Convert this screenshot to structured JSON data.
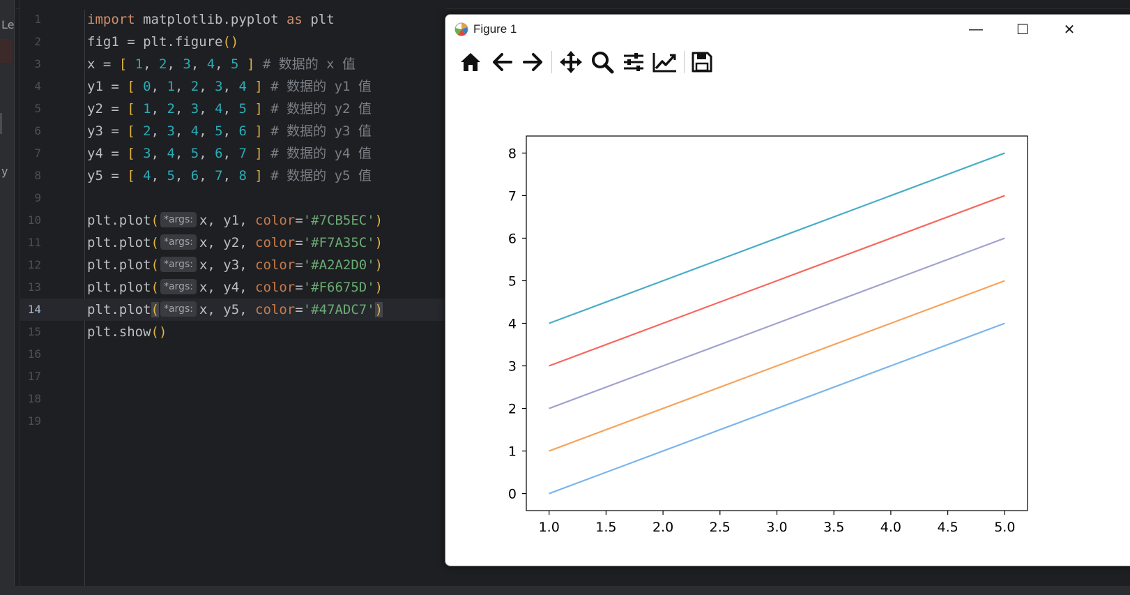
{
  "left_panel": {
    "fragment_top": "Le",
    "fragment_mid": "y"
  },
  "editor": {
    "line_numbers": [
      "1",
      "2",
      "3",
      "4",
      "5",
      "6",
      "7",
      "8",
      "9",
      "10",
      "11",
      "12",
      "13",
      "14",
      "15",
      "16",
      "17",
      "18",
      "19"
    ],
    "current_line": 14,
    "lines": {
      "l1": [
        "import",
        " matplotlib.pyplot ",
        "as",
        " plt"
      ],
      "l2": [
        "fig1 = plt.figure",
        "(",
        ")"
      ],
      "l3": [
        "x = ",
        "[",
        " ",
        "1",
        ", ",
        "2",
        ", ",
        "3",
        ", ",
        "4",
        ", ",
        "5",
        " ",
        "]",
        " ",
        "# 数据的 x 值"
      ],
      "l4": [
        "y1 = ",
        "[",
        " ",
        "0",
        ", ",
        "1",
        ", ",
        "2",
        ", ",
        "3",
        ", ",
        "4",
        " ",
        "]",
        " ",
        "# 数据的 y1 值"
      ],
      "l5": [
        "y2 = ",
        "[",
        " ",
        "1",
        ", ",
        "2",
        ", ",
        "3",
        ", ",
        "4",
        ", ",
        "5",
        " ",
        "]",
        " ",
        "# 数据的 y2 值"
      ],
      "l6": [
        "y3 = ",
        "[",
        " ",
        "2",
        ", ",
        "3",
        ", ",
        "4",
        ", ",
        "5",
        ", ",
        "6",
        " ",
        "]",
        " ",
        "# 数据的 y3 值"
      ],
      "l7": [
        "y4 = ",
        "[",
        " ",
        "3",
        ", ",
        "4",
        ", ",
        "5",
        ", ",
        "6",
        ", ",
        "7",
        " ",
        "]",
        " ",
        "# 数据的 y4 值"
      ],
      "l8": [
        "y5 = ",
        "[",
        " ",
        "4",
        ", ",
        "5",
        ", ",
        "6",
        ", ",
        "7",
        ", ",
        "8",
        " ",
        "]",
        " ",
        "# 数据的 y5 值"
      ],
      "l10": [
        "plt.plot",
        "(",
        "*args:",
        "x, y1, ",
        "color",
        "=",
        "'#7CB5EC'",
        ")"
      ],
      "l11": [
        "plt.plot",
        "(",
        "*args:",
        "x, y2, ",
        "color",
        "=",
        "'#F7A35C'",
        ")"
      ],
      "l12": [
        "plt.plot",
        "(",
        "*args:",
        "x, y3, ",
        "color",
        "=",
        "'#A2A2D0'",
        ")"
      ],
      "l13": [
        "plt.plot",
        "(",
        "*args:",
        "x, y4, ",
        "color",
        "=",
        "'#F6675D'",
        ")"
      ],
      "l14": [
        "plt.plot",
        "(",
        "*args:",
        "x, y5, ",
        "color",
        "=",
        "'#47ADC7'",
        ")"
      ],
      "l15": [
        "plt.show",
        "(",
        ")"
      ]
    }
  },
  "figure_window": {
    "title": "Figure 1",
    "controls": {
      "minimize": "—",
      "maximize": "☐",
      "close": "✕"
    },
    "toolbar": [
      "home",
      "back",
      "forward",
      "pan",
      "zoom",
      "configure-subplots",
      "edit-axis",
      "save"
    ]
  },
  "chart_data": {
    "type": "line",
    "x": [
      1,
      2,
      3,
      4,
      5
    ],
    "series": [
      {
        "values": [
          0,
          1,
          2,
          3,
          4
        ],
        "color": "#7CB5EC"
      },
      {
        "values": [
          1,
          2,
          3,
          4,
          5
        ],
        "color": "#F7A35C"
      },
      {
        "values": [
          2,
          3,
          4,
          5,
          6
        ],
        "color": "#A2A2D0"
      },
      {
        "values": [
          3,
          4,
          5,
          6,
          7
        ],
        "color": "#F6675D"
      },
      {
        "values": [
          4,
          5,
          6,
          7,
          8
        ],
        "color": "#47ADC7"
      }
    ],
    "xlim": [
      0.8,
      5.2
    ],
    "ylim": [
      -0.4,
      8.4
    ],
    "xticks": [
      1.0,
      1.5,
      2.0,
      2.5,
      3.0,
      3.5,
      4.0,
      4.5,
      5.0
    ],
    "xtick_labels": [
      "1.0",
      "1.5",
      "2.0",
      "2.5",
      "3.0",
      "3.5",
      "4.0",
      "4.5",
      "5.0"
    ],
    "yticks": [
      0,
      1,
      2,
      3,
      4,
      5,
      6,
      7,
      8
    ],
    "ytick_labels": [
      "0",
      "1",
      "2",
      "3",
      "4",
      "5",
      "6",
      "7",
      "8"
    ],
    "title": "",
    "xlabel": "",
    "ylabel": "",
    "grid": false
  }
}
